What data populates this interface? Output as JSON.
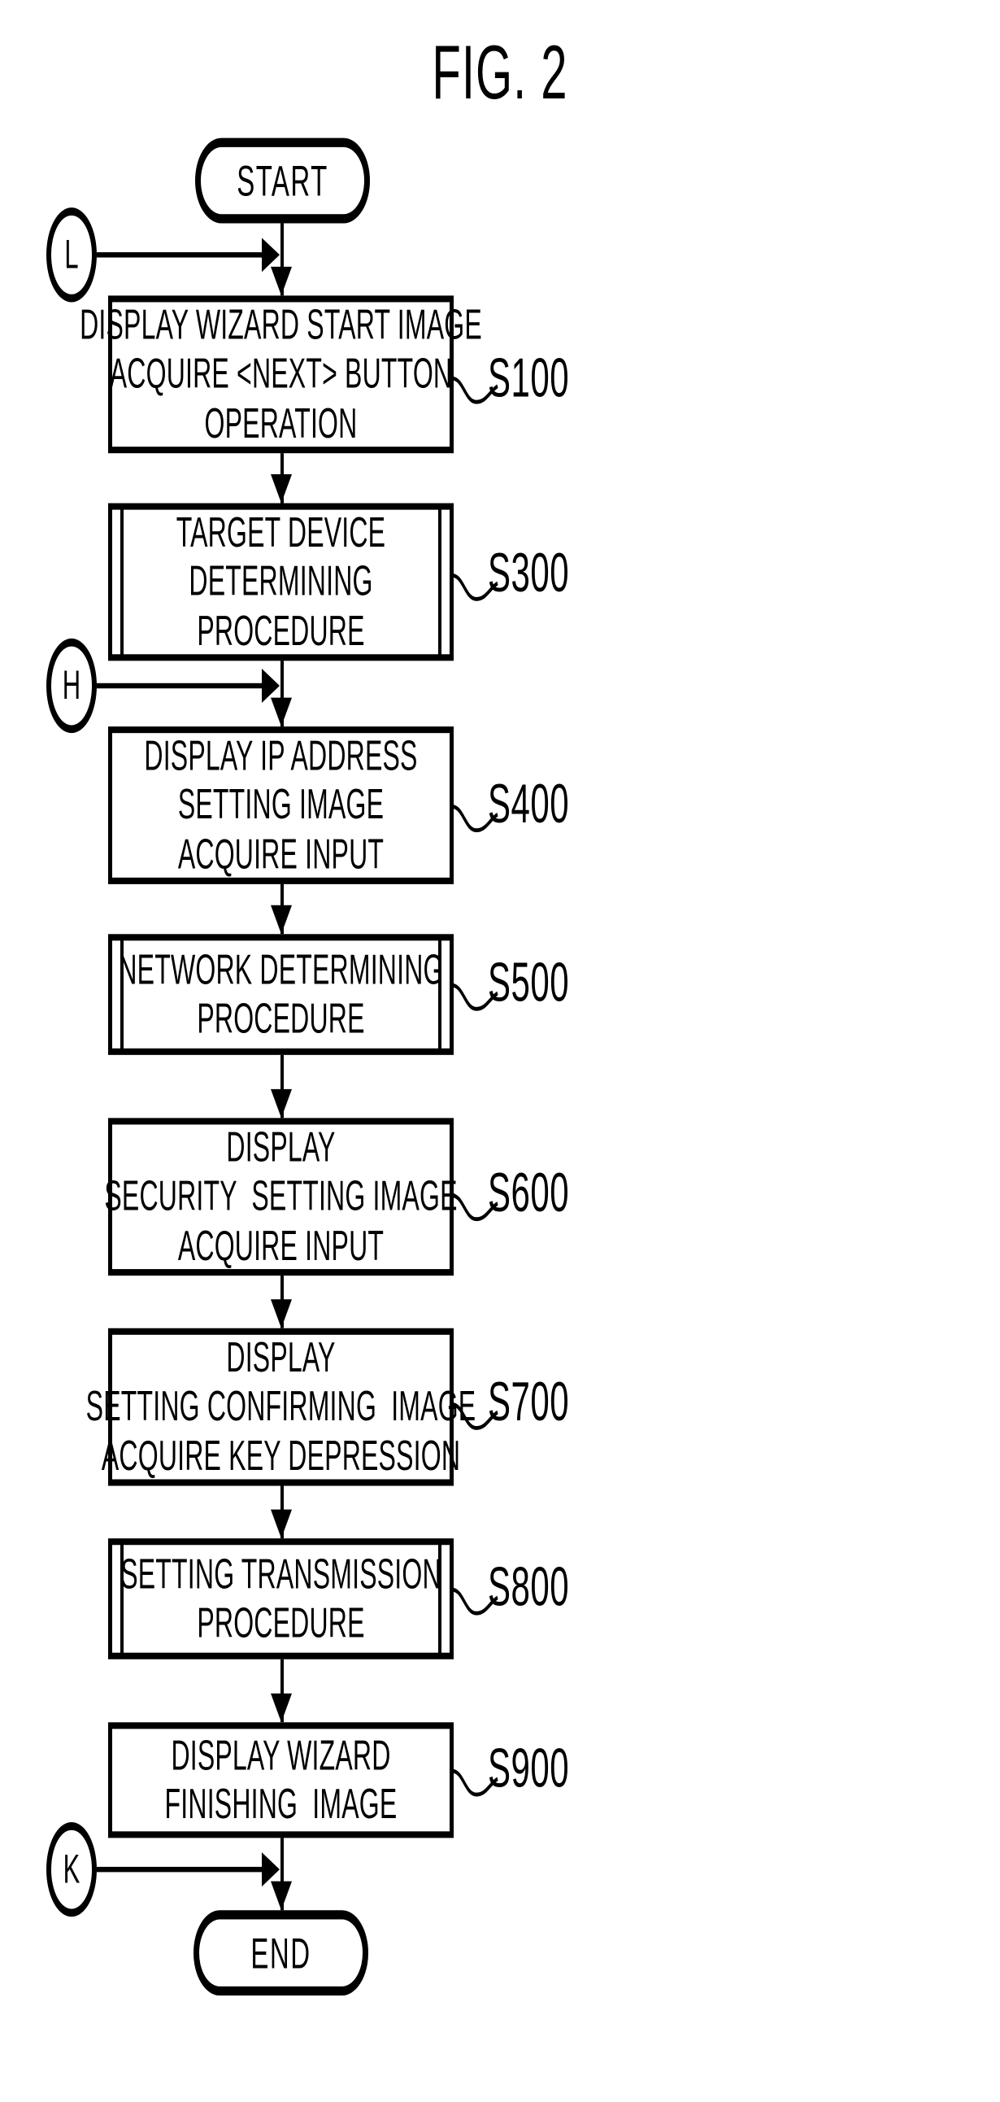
{
  "figure": {
    "title": "FIG. 2",
    "type": "flowchart"
  },
  "terminators": {
    "start": "START",
    "end": "END"
  },
  "connectors": [
    {
      "id": "L",
      "label": "L"
    },
    {
      "id": "H",
      "label": "H"
    },
    {
      "id": "K",
      "label": "K"
    }
  ],
  "steps": [
    {
      "ref": "S100",
      "shape": "process",
      "lines": [
        "DISPLAY WIZARD START IMAGE",
        "ACQUIRE <NEXT> BUTTON",
        "OPERATION"
      ]
    },
    {
      "ref": "S300",
      "shape": "predefined-process",
      "lines": [
        "TARGET DEVICE",
        "DETERMINING",
        "PROCEDURE"
      ]
    },
    {
      "ref": "S400",
      "shape": "process",
      "lines": [
        "DISPLAY IP ADDRESS",
        "SETTING IMAGE",
        "ACQUIRE INPUT"
      ]
    },
    {
      "ref": "S500",
      "shape": "predefined-process",
      "lines": [
        "NETWORK DETERMINING",
        "PROCEDURE"
      ]
    },
    {
      "ref": "S600",
      "shape": "process",
      "lines": [
        "DISPLAY",
        "SECURITY  SETTING IMAGE",
        "ACQUIRE INPUT"
      ]
    },
    {
      "ref": "S700",
      "shape": "process",
      "lines": [
        "DISPLAY",
        "SETTING CONFIRMING  IMAGE",
        "ACQUIRE KEY DEPRESSION"
      ]
    },
    {
      "ref": "S800",
      "shape": "predefined-process",
      "lines": [
        "SETTING TRANSMISSION",
        "PROCEDURE"
      ]
    },
    {
      "ref": "S900",
      "shape": "process",
      "lines": [
        "DISPLAY WIZARD",
        "FINISHING  IMAGE"
      ]
    }
  ],
  "colors": {
    "ink": "#000000",
    "paper": "#ffffff"
  }
}
